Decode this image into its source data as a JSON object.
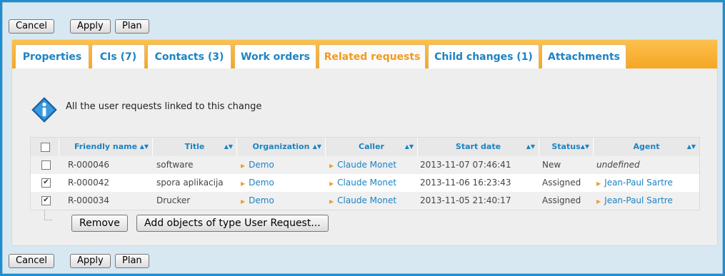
{
  "toolbar": {
    "cancel_label": "Cancel",
    "apply_label": "Apply",
    "plan_label": "Plan"
  },
  "tabs": [
    {
      "label": "Properties"
    },
    {
      "label": "CIs (7)"
    },
    {
      "label": "Contacts (3)"
    },
    {
      "label": "Work orders"
    },
    {
      "label": "Related requests",
      "active": true
    },
    {
      "label": "Child changes (1)"
    },
    {
      "label": "Attachments"
    }
  ],
  "info": {
    "icon": "info-icon",
    "text": "All the user requests linked to this change"
  },
  "table": {
    "columns": [
      "Friendly name",
      "Title",
      "Organization",
      "Caller",
      "Start date",
      "Status",
      "Agent"
    ],
    "rows": [
      {
        "checked": false,
        "friendly_name": "R-000046",
        "title": "software",
        "organization": "Demo",
        "caller": "Claude Monet",
        "start_date": "2013-11-07 07:46:41",
        "status": "New",
        "agent": "undefined"
      },
      {
        "checked": true,
        "friendly_name": "R-000042",
        "title": "spora aplikacija",
        "organization": "Demo",
        "caller": "Claude Monet",
        "start_date": "2013-11-06 16:23:43",
        "status": "Assigned",
        "agent": "Jean-Paul Sartre"
      },
      {
        "checked": true,
        "friendly_name": "R-000034",
        "title": "Drucker",
        "organization": "Demo",
        "caller": "Claude Monet",
        "start_date": "2013-11-05 21:40:17",
        "status": "Assigned",
        "agent": "Jean-Paul Sartre"
      }
    ]
  },
  "actions": {
    "remove_label": "Remove",
    "add_label": "Add objects of type User Request..."
  },
  "colors": {
    "accent": "#1c83c4",
    "tab_bar": "#f5a623",
    "active_tab": "#f29a1c",
    "frame": "#1d8fd0"
  }
}
